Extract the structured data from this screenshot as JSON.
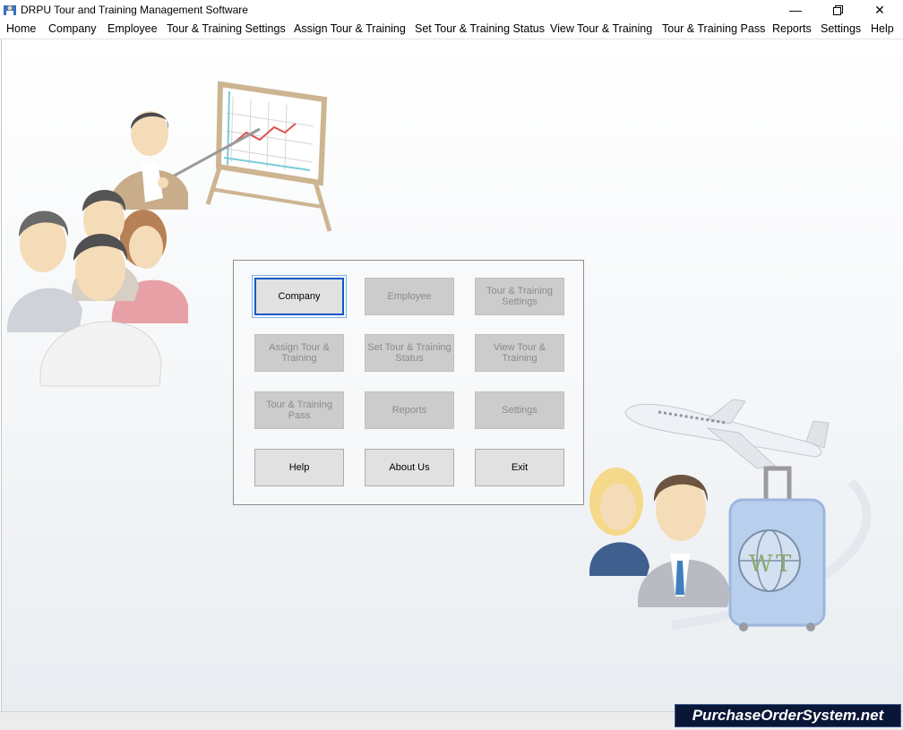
{
  "window": {
    "title": "DRPU Tour and Training Management Software",
    "minimize_icon": "minimize-icon",
    "maximize_icon": "restore-icon",
    "close_icon": "close-icon"
  },
  "menu": {
    "items": [
      "Home",
      "Company",
      "Employee",
      "Tour & Training Settings",
      "Assign Tour & Training",
      "Set Tour & Training Status",
      "View Tour & Training",
      "Tour & Training Pass",
      "Reports",
      "Settings",
      "Help"
    ]
  },
  "panel": {
    "buttons": [
      {
        "label": "Company",
        "enabled": true,
        "focused": true
      },
      {
        "label": "Employee",
        "enabled": false
      },
      {
        "label": "Tour & Training Settings",
        "enabled": false
      },
      {
        "label": "Assign Tour & Training",
        "enabled": false
      },
      {
        "label": "Set Tour & Training Status",
        "enabled": false
      },
      {
        "label": "View Tour & Training",
        "enabled": false
      },
      {
        "label": "Tour & Training Pass",
        "enabled": false
      },
      {
        "label": "Reports",
        "enabled": false
      },
      {
        "label": "Settings",
        "enabled": false
      },
      {
        "label": "Help",
        "enabled": true
      },
      {
        "label": "About Us",
        "enabled": true
      },
      {
        "label": "Exit",
        "enabled": true
      }
    ]
  },
  "illustrations": {
    "presentation_scene": "training-presentation-illustration",
    "travel_scene": "travel-illustration",
    "luggage_letters": [
      "W",
      "T"
    ]
  },
  "watermark": "PurchaseOrderSystem.net",
  "colors": {
    "focus_border": "#0a58c7",
    "disabled_button": "#cccccc",
    "enabled_button": "#e1e1e1",
    "watermark_bg": "#0a1636"
  }
}
